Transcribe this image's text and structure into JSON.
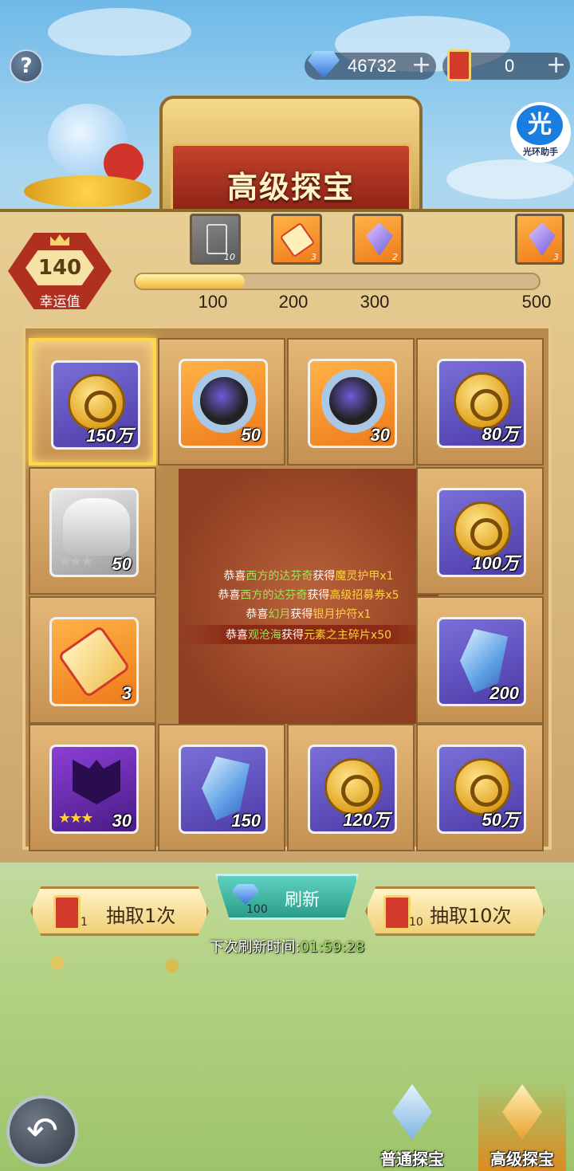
{
  "currency": {
    "diamonds": "46732",
    "tickets": "0"
  },
  "assistant": {
    "icon_char": "光",
    "label": "光环助手"
  },
  "banner": {
    "title": "高级探宝"
  },
  "luck": {
    "value": "140",
    "label": "幸运值"
  },
  "progress": {
    "fraction": 0.27,
    "milestones": [
      {
        "threshold": "100",
        "count": "10",
        "icon": "card-icon"
      },
      {
        "threshold": "200",
        "count": "3",
        "icon": "scroll-icon"
      },
      {
        "threshold": "300",
        "count": "2",
        "icon": "gem-amulet-icon"
      },
      {
        "threshold": "500",
        "count": "3",
        "icon": "gem-amulet-icon"
      }
    ]
  },
  "grid": [
    {
      "qty": "150万",
      "kind": "coin"
    },
    {
      "qty": "50",
      "kind": "orb"
    },
    {
      "qty": "30",
      "kind": "orb"
    },
    {
      "qty": "80万",
      "kind": "coin"
    },
    {
      "qty": "50",
      "kind": "hero-shard"
    },
    {
      "qty": "100万",
      "kind": "coin"
    },
    {
      "qty": "3",
      "kind": "scroll"
    },
    {
      "qty": "200",
      "kind": "crystal"
    },
    {
      "qty": "30",
      "kind": "dark-shard"
    },
    {
      "qty": "150",
      "kind": "crystal"
    },
    {
      "qty": "120万",
      "kind": "coin"
    },
    {
      "qty": "50万",
      "kind": "coin"
    }
  ],
  "broadcast": [
    {
      "pre": "恭喜",
      "player": "西方的达芬奇",
      "mid": "获得",
      "item": "魔灵护甲x1"
    },
    {
      "pre": "恭喜",
      "player": "西方的达芬奇",
      "mid": "获得",
      "item": "高级招募券x5"
    },
    {
      "pre": "恭喜",
      "player": "幻月",
      "mid": "获得",
      "item": "银月护符x1"
    },
    {
      "pre": "恭喜",
      "player": "观沧海",
      "mid": "获得",
      "item": "元素之主碎片x50"
    }
  ],
  "controls": {
    "draw_one": {
      "label": "抽取1次",
      "cost": "1"
    },
    "refresh": {
      "label": "刷新",
      "cost": "100"
    },
    "draw_ten": {
      "label": "抽取10次",
      "cost": "10"
    },
    "timer_label": "下次刷新时间:",
    "timer_value": "01:59:28"
  },
  "tabs": {
    "normal": "普通探宝",
    "advanced": "高级探宝"
  },
  "help_label": "?",
  "back_label": "↶"
}
